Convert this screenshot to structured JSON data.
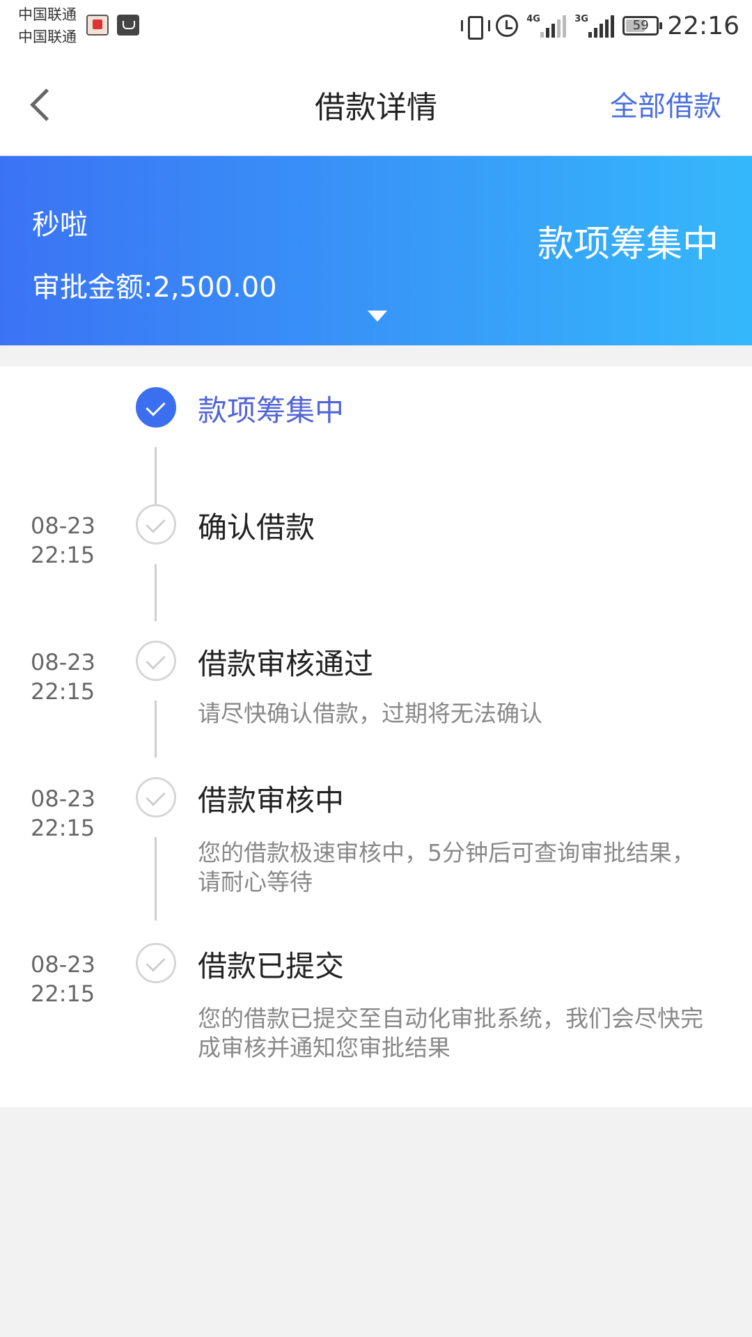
{
  "status_bar": {
    "carrier1": "中国联通",
    "carrier2": "中国联通",
    "network1": "4G",
    "network2": "3G",
    "battery": "59",
    "time": "22:16"
  },
  "nav": {
    "title": "借款详情",
    "right_link": "全部借款"
  },
  "loan": {
    "lender": "秒啦",
    "approval_amount": "审批金额:2,500.00",
    "status": "款项筹集中",
    "accent_colors": [
      "#3b73f4",
      "#35b8fb"
    ]
  },
  "timeline": [
    {
      "date": "",
      "time": "",
      "title": "款项筹集中",
      "desc": "",
      "active": true
    },
    {
      "date": "08-23",
      "time": "22:15",
      "title": "确认借款",
      "desc": "",
      "active": false
    },
    {
      "date": "08-23",
      "time": "22:15",
      "title": "借款审核通过",
      "desc": "请尽快确认借款，过期将无法确认",
      "active": false
    },
    {
      "date": "08-23",
      "time": "22:15",
      "title": "借款审核中",
      "desc": "您的借款极速审核中，5分钟后可查询审批结果，请耐心等待",
      "active": false
    },
    {
      "date": "08-23",
      "time": "22:15",
      "title": "借款已提交",
      "desc": "您的借款已提交至自动化审批系统，我们会尽快完成审核并通知您审批结果",
      "active": false
    }
  ]
}
